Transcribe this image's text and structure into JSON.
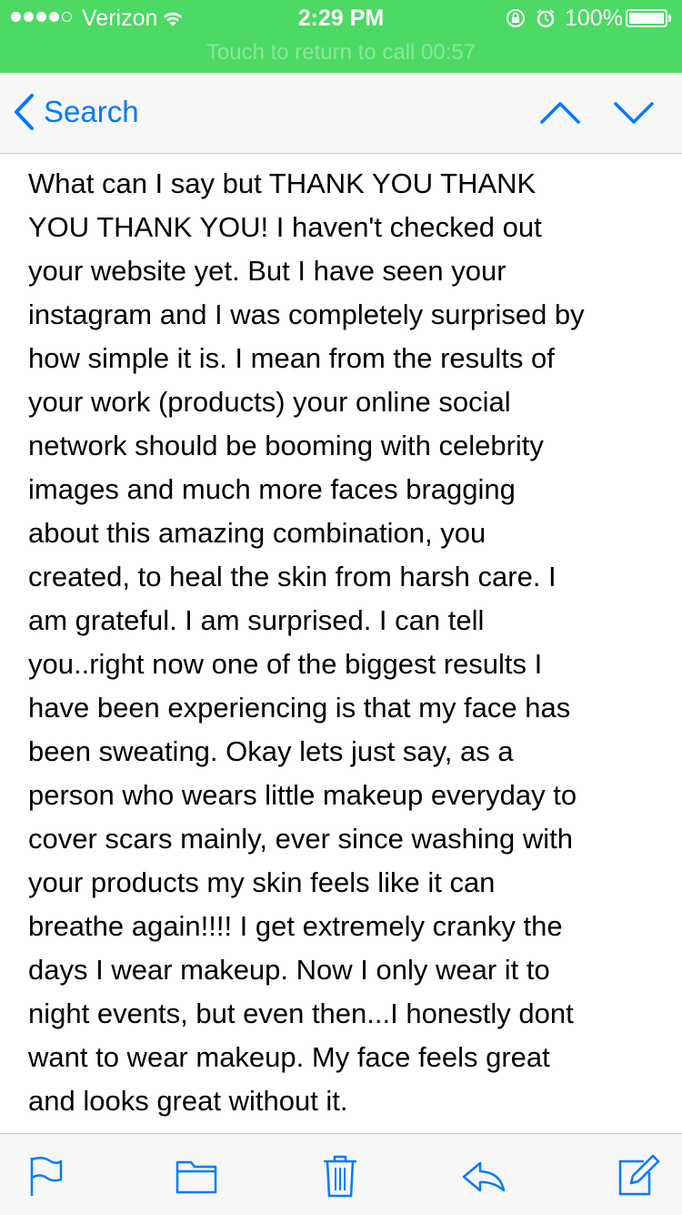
{
  "status_bar": {
    "carrier": "Verizon",
    "time": "2:29 PM",
    "battery_percent": "100%",
    "signal_bars_filled": 4,
    "signal_bars_total": 5,
    "call_banner": "Touch to return to call  00:57",
    "background_color": "#4cd964"
  },
  "nav": {
    "back_label": "Search",
    "previous_icon": "chevron-up-icon",
    "next_icon": "chevron-down-icon",
    "accent_color": "#007aff"
  },
  "message": {
    "body": "What can I say but THANK YOU THANK\nYOU THANK YOU! I haven't checked out\nyour website yet. But I have seen your\ninstagram and I was completely surprised by\nhow simple it is. I mean from the results of\nyour work (products) your online social\nnetwork should be booming with celebrity\nimages and much more faces bragging\nabout this amazing combination, you\ncreated,  to heal the skin from harsh care. I\nam grateful. I am surprised. I can tell\nyou..right now one of the biggest results I\nhave been experiencing is that my face has\nbeen sweating. Okay lets just say, as a\nperson who wears little makeup everyday to\ncover scars mainly, ever since washing with\nyour products my skin feels like it can\nbreathe again!!!! I get extremely cranky the\ndays I wear makeup. Now I only wear it to\nnight events, but even then...I honestly dont\nwant to wear makeup. My face feels great\nand looks great without it."
  },
  "toolbar": {
    "icons": [
      "flag-icon",
      "folder-icon",
      "trash-icon",
      "reply-icon",
      "compose-icon"
    ]
  }
}
